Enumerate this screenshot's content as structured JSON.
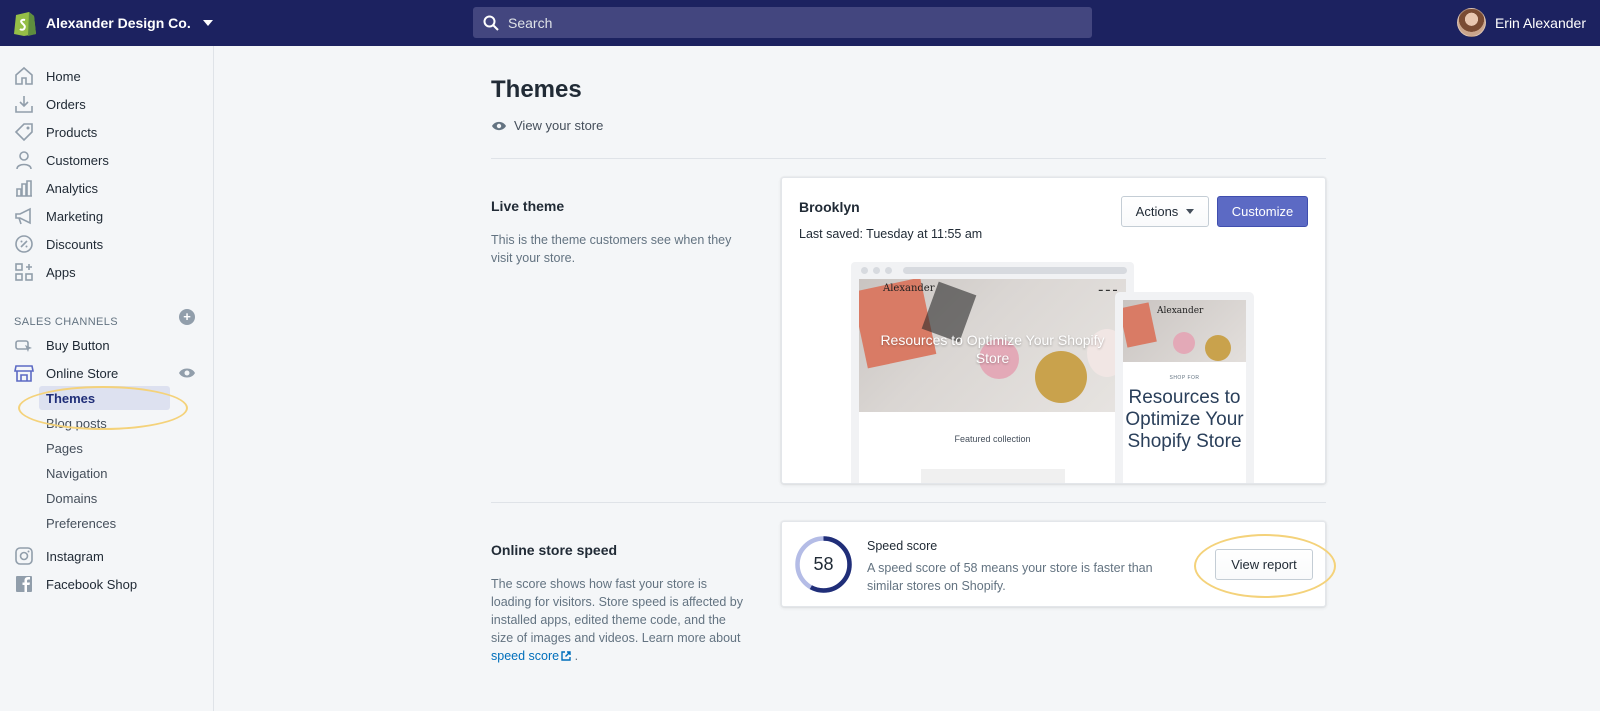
{
  "topbar": {
    "store_name": "Alexander Design Co.",
    "search_placeholder": "Search",
    "user_name": "Erin Alexander"
  },
  "sidebar": {
    "items": [
      {
        "label": "Home",
        "icon": "home-icon"
      },
      {
        "label": "Orders",
        "icon": "orders-icon"
      },
      {
        "label": "Products",
        "icon": "tag-icon"
      },
      {
        "label": "Customers",
        "icon": "person-icon"
      },
      {
        "label": "Analytics",
        "icon": "bar-chart-icon"
      },
      {
        "label": "Marketing",
        "icon": "megaphone-icon"
      },
      {
        "label": "Discounts",
        "icon": "discount-icon"
      },
      {
        "label": "Apps",
        "icon": "apps-icon"
      }
    ],
    "sales_channels_title": "SALES CHANNELS",
    "channels": [
      {
        "label": "Buy Button",
        "icon": "buy-button-icon"
      },
      {
        "label": "Online Store",
        "icon": "store-icon"
      }
    ],
    "online_store_sub": [
      "Themes",
      "Blog posts",
      "Pages",
      "Navigation",
      "Domains",
      "Preferences"
    ],
    "social": [
      {
        "label": "Instagram",
        "icon": "instagram-icon"
      },
      {
        "label": "Facebook Shop",
        "icon": "facebook-icon"
      }
    ]
  },
  "main": {
    "title": "Themes",
    "view_store": "View your store",
    "live_theme": {
      "title": "Live theme",
      "description": "This is the theme customers see when they visit your store.",
      "theme_name": "Brooklyn",
      "last_saved": "Last saved: Tuesday at 11:55 am",
      "actions_label": "Actions",
      "customize_label": "Customize",
      "preview": {
        "brand": "Alexander",
        "hero_text": "Resources to Optimize Your Shopify Store",
        "featured": "Featured collection",
        "mobile_shop_for": "SHOP FOR",
        "mobile_text": "Resources to Optimize Your Shopify Store"
      }
    },
    "speed": {
      "title": "Online store speed",
      "description_prefix": "The score shows how fast your store is loading for visitors. Store speed is affected by installed apps, edited theme code, and the size of images and videos. Learn more about ",
      "link_label": "speed score",
      "description_suffix": " .",
      "score": 58,
      "score_max": 100,
      "card_title": "Speed score",
      "card_desc": "A speed score of 58 means your store is faster than similar stores on Shopify.",
      "button_label": "View report"
    }
  },
  "colors": {
    "topbar": "#1c2260",
    "accent": "#5c6ac4",
    "highlight": "#f4d27a",
    "link": "#006fbb"
  }
}
